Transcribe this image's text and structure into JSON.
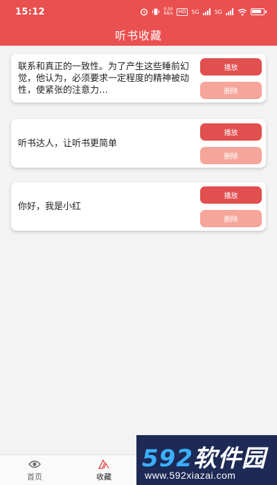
{
  "status": {
    "time": "15:12",
    "speed": "0.50",
    "speed_unit": "KB/s",
    "hd_label": "HD",
    "net1": "5G",
    "net2": "5G"
  },
  "header": {
    "title": "听书收藏"
  },
  "items": [
    {
      "text": "联系和真正的一致性。为了产生这些睡前幻觉，他认为，必须要求一定程度的精神被动性，使紧张的注意力…",
      "play_label": "播放",
      "delete_label": "删除"
    },
    {
      "text": "听书达人，让听书更简单",
      "play_label": "播放",
      "delete_label": "删除"
    },
    {
      "text": "你好，我是小红",
      "play_label": "播放",
      "delete_label": "删除"
    }
  ],
  "tabs": [
    {
      "label": "首页",
      "icon": "eye-icon"
    },
    {
      "label": "收藏",
      "icon": "favorite-icon",
      "active": true
    }
  ],
  "watermark": {
    "logo_num": "592",
    "logo_text": "软件园",
    "url": "www.592xiazai.com"
  },
  "colors": {
    "primary": "#ea5050",
    "play": "#e24f4f",
    "delete": "#f6a59a"
  }
}
